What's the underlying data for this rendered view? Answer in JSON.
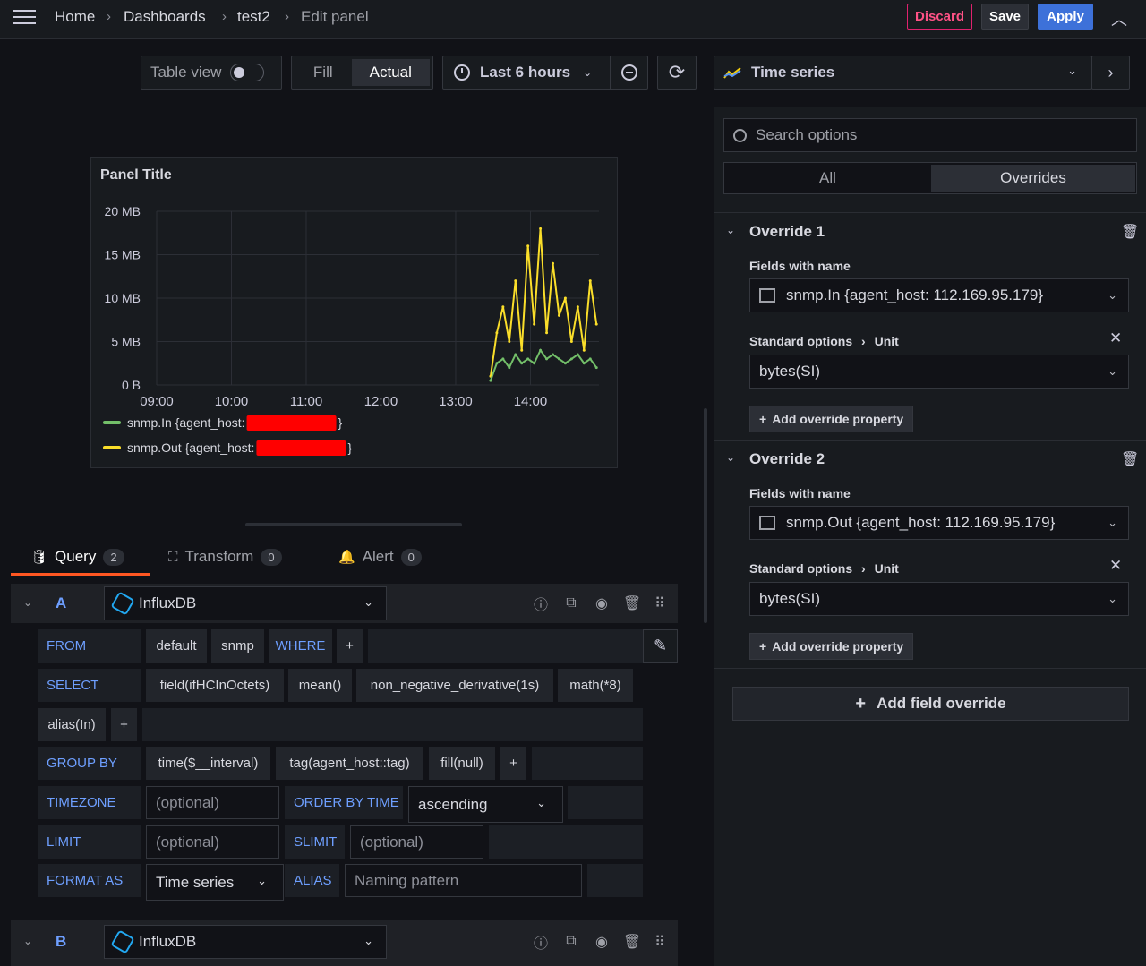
{
  "breadcrumb": {
    "home": "Home",
    "dashboards": "Dashboards",
    "dash": "test2",
    "current": "Edit panel",
    "sep": "›"
  },
  "top_actions": {
    "discard": "Discard",
    "save": "Save",
    "apply": "Apply"
  },
  "toolbar": {
    "table_view": "Table view",
    "fill": "Fill",
    "actual": "Actual",
    "time_range": "Last 6 hours"
  },
  "viz": {
    "type": "Time series"
  },
  "panel": {
    "title": "Panel Title"
  },
  "chart_data": {
    "type": "line",
    "title": "Panel Title",
    "y_ticks": [
      "20 MB",
      "15 MB",
      "10 MB",
      "5 MB",
      "0 B"
    ],
    "x_ticks": [
      "09:00",
      "10:00",
      "11:00",
      "12:00",
      "13:00",
      "14:00"
    ],
    "ylim": [
      0,
      20
    ],
    "y_unit": "MB",
    "series": [
      {
        "name": "snmp.In {agent_host: ",
        "suffix": "}",
        "color": "#73bf69",
        "x": [
          "13:28",
          "13:33",
          "13:38",
          "13:43",
          "13:48",
          "13:53",
          "13:58",
          "14:03",
          "14:08",
          "14:13",
          "14:18",
          "14:23",
          "14:28",
          "14:33",
          "14:38",
          "14:43",
          "14:48",
          "14:53"
        ],
        "values": [
          0.5,
          2.5,
          3,
          2,
          3.5,
          2.5,
          3,
          2.5,
          4,
          3,
          3.5,
          3,
          2.5,
          3,
          3.5,
          2.5,
          3,
          2
        ]
      },
      {
        "name": "snmp.Out {agent_host: ",
        "suffix": "}",
        "color": "#fade2a",
        "x": [
          "13:28",
          "13:33",
          "13:38",
          "13:43",
          "13:48",
          "13:53",
          "13:58",
          "14:03",
          "14:08",
          "14:13",
          "14:18",
          "14:23",
          "14:28",
          "14:33",
          "14:38",
          "14:43",
          "14:48",
          "14:53"
        ],
        "values": [
          1,
          6,
          9,
          5,
          12,
          4,
          16,
          7,
          18,
          6,
          14,
          8,
          10,
          5,
          9,
          4,
          12,
          7
        ]
      }
    ],
    "legend": "bottom-left"
  },
  "query_tabs": [
    {
      "label": "Query",
      "count": "2"
    },
    {
      "label": "Transform",
      "count": "0"
    },
    {
      "label": "Alert",
      "count": "0"
    }
  ],
  "queryA": {
    "letter": "A",
    "datasource": "InfluxDB",
    "from": {
      "kw": "FROM",
      "policy": "default",
      "measurement": "snmp",
      "where": "WHERE",
      "plus": "+"
    },
    "select": {
      "kw": "SELECT",
      "field": "field(ifHCInOctets)",
      "mean": "mean()",
      "deriv": "non_negative_derivative(1s)",
      "math": "math(*8)",
      "alias": "alias(In)",
      "plus": "+"
    },
    "group": {
      "kw": "GROUP BY",
      "time": "time($__interval)",
      "tag": "tag(agent_host::tag)",
      "fill": "fill(null)",
      "plus": "+"
    },
    "timezone": {
      "kw": "TIMEZONE",
      "placeholder": "(optional)",
      "order_kw": "ORDER BY TIME",
      "order_val": "ascending"
    },
    "limit": {
      "kw": "LIMIT",
      "placeholder": "(optional)",
      "slimit_kw": "SLIMIT",
      "slimit_placeholder": "(optional)"
    },
    "format": {
      "kw": "FORMAT AS",
      "value": "Time series",
      "alias_kw": "ALIAS",
      "alias_placeholder": "Naming pattern"
    }
  },
  "queryB": {
    "letter": "B",
    "datasource": "InfluxDB"
  },
  "options": {
    "search_placeholder": "Search options",
    "tab_all": "All",
    "tab_overrides": "Overrides"
  },
  "overrides": [
    {
      "title": "Override 1",
      "matcher_label": "Fields with name",
      "matcher_value": "snmp.In {agent_host: 112.169.95.179}",
      "prop_path": "Standard options",
      "prop_sep": "›",
      "prop_name": "Unit",
      "prop_value": "bytes(SI)",
      "add_prop": "Add override property"
    },
    {
      "title": "Override 2",
      "matcher_label": "Fields with name",
      "matcher_value": "snmp.Out {agent_host: 112.169.95.179}",
      "prop_path": "Standard options",
      "prop_sep": "›",
      "prop_name": "Unit",
      "prop_value": "bytes(SI)",
      "add_prop": "Add override property"
    }
  ],
  "add_field_override": "Add field override",
  "colors": {
    "bg": "#111217",
    "panel": "#181b1f",
    "primary": "#3d71d9",
    "discard": "#e0226e",
    "accent": "#ff5722"
  }
}
